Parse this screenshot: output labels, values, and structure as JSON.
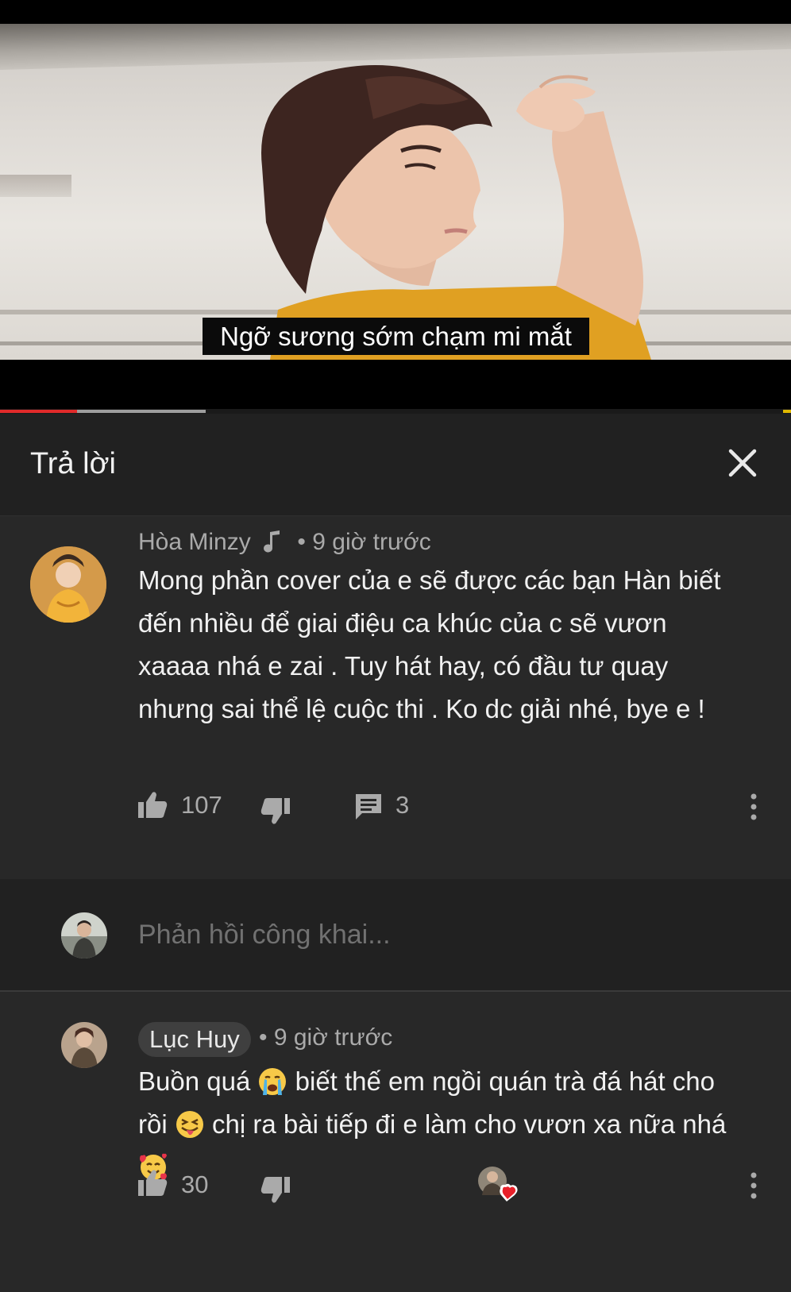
{
  "video": {
    "subtitle": "Ngỡ sương sớm chạm mi mắt",
    "played_fraction": 0.097,
    "buffered_fraction": 0.26,
    "colors": {
      "played": "#e12a2a",
      "buffered": "#9e9e9e",
      "chapter_end": "#e0b800"
    }
  },
  "header": {
    "title": "Trả lời",
    "close_icon": "close-icon"
  },
  "main_comment": {
    "author": "Hòa Minzy",
    "author_badge_icon": "music-note-icon",
    "time": "• 9 giờ trước",
    "text": "Mong phần cover của e sẽ được các bạn Hàn biết đến nhiều để giai điệu ca khúc của c sẽ vươn xaaaa nhá e zai . Tuy hát hay, có đầu tư quay nhưng sai thể lệ cuộc thi . Ko dc giải nhé, bye e !",
    "likes": "107",
    "replies": "3",
    "icons": [
      "like-icon",
      "dislike-icon",
      "reply-count-icon",
      "more-options-icon"
    ]
  },
  "reply_input": {
    "placeholder": "Phản hồi công khai..."
  },
  "reply": {
    "author": "Lục Huy",
    "time": "• 9 giờ trước",
    "text_parts": [
      "Buồn quá ",
      " biết thế em ngồi quán trà đá hát cho rồi ",
      " chị ra bài tiếp đi e làm cho vươn xa nữa nhá "
    ],
    "emojis": [
      "crying-face-emoji",
      "tongue-wink-emoji",
      "smiling-hearts-emoji"
    ],
    "likes": "30",
    "icons": [
      "like-icon",
      "dislike-icon",
      "creator-heart-icon",
      "more-options-icon"
    ]
  }
}
